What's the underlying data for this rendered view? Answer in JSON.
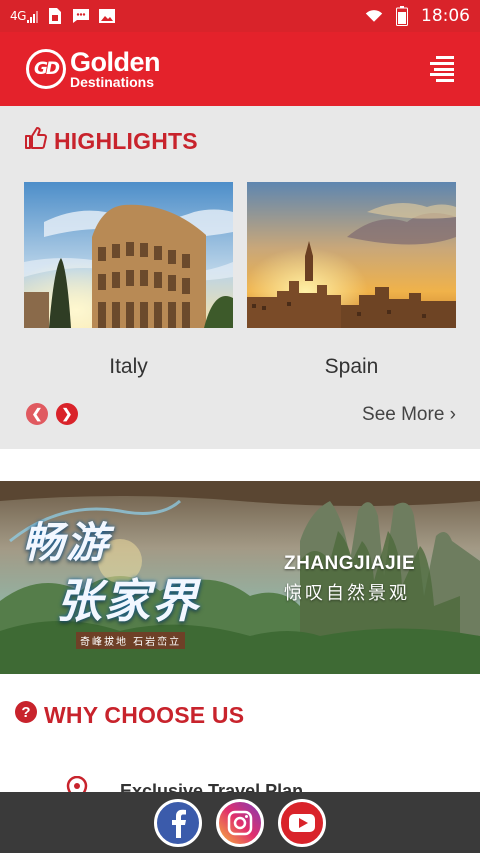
{
  "status_bar": {
    "network": "4G",
    "time": "18:06",
    "icons": [
      "sim-icon",
      "message-icon",
      "image-icon",
      "wifi-icon",
      "battery-icon"
    ]
  },
  "header": {
    "logo_mark": "GD",
    "logo_name": "Golden",
    "logo_sub": "Destinations",
    "menu_icon": "hamburger-menu-icon",
    "color": "#e4222b"
  },
  "highlights": {
    "title": "HIGHLIGHTS",
    "icon": "thumbs-up-icon",
    "cards": [
      {
        "label": "Italy"
      },
      {
        "label": "Spain"
      }
    ],
    "see_more": "See More ›",
    "prev_icon": "chevron-left-icon",
    "next_icon": "chevron-right-icon"
  },
  "banner": {
    "title_big_line1": "畅游",
    "title_big_line2": "张家界",
    "tagline": "奇峰拔地  石岩峦立",
    "title_en": "ZHANGJIAJIE",
    "subtitle_zh": "惊叹自然景观"
  },
  "why_choose_us": {
    "title": "WHY CHOOSE US",
    "icon": "question-circle-icon",
    "features": [
      {
        "label": "Exclusive Travel Plan",
        "icon": "map-pin-icon"
      }
    ]
  },
  "social": {
    "items": [
      {
        "name": "facebook-icon"
      },
      {
        "name": "instagram-icon"
      },
      {
        "name": "youtube-icon"
      }
    ]
  },
  "colors": {
    "accent": "#d9232a",
    "highlight_bg": "#e8e8e8",
    "social_bg": "#3a3a3a"
  }
}
